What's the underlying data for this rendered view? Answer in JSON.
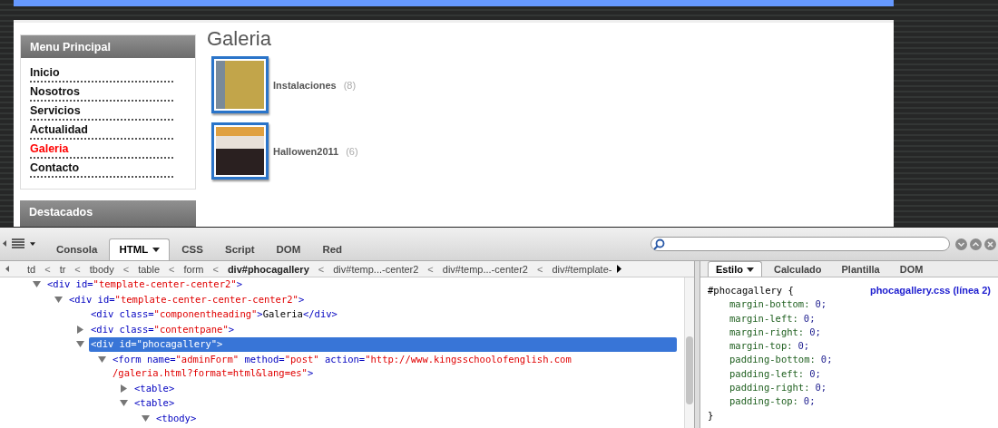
{
  "page": {
    "menu": {
      "title": "Menu Principal",
      "items": [
        {
          "label": "Inicio",
          "selected": false
        },
        {
          "label": "Nosotros",
          "selected": false
        },
        {
          "label": "Servicios",
          "selected": false
        },
        {
          "label": "Actualidad",
          "selected": false
        },
        {
          "label": "Galeria",
          "selected": true
        },
        {
          "label": "Contacto",
          "selected": false
        }
      ]
    },
    "featured": {
      "title": "Destacados"
    },
    "heading": "Galeria",
    "albums": [
      {
        "name": "Instalaciones",
        "count": "(8)"
      },
      {
        "name": "Hallowen2011",
        "count": "(6)"
      }
    ]
  },
  "devtools": {
    "tabs": [
      {
        "label": "Consola",
        "selected": false,
        "dropdown": false
      },
      {
        "label": "HTML",
        "selected": true,
        "dropdown": true
      },
      {
        "label": "CSS",
        "selected": false,
        "dropdown": false
      },
      {
        "label": "Script",
        "selected": false,
        "dropdown": false
      },
      {
        "label": "DOM",
        "selected": false,
        "dropdown": false
      },
      {
        "label": "Red",
        "selected": false,
        "dropdown": false
      }
    ],
    "breadcrumb": [
      {
        "label": "td",
        "selected": false,
        "separator": "<"
      },
      {
        "label": "tr",
        "selected": false,
        "separator": "<"
      },
      {
        "label": "tbody",
        "selected": false,
        "separator": "<"
      },
      {
        "label": "table",
        "selected": false,
        "separator": "<"
      },
      {
        "label": "form",
        "selected": false,
        "separator": "<"
      },
      {
        "label": "div#phocagallery",
        "selected": true,
        "separator": "<"
      },
      {
        "label": "div#temp...-center2",
        "selected": false,
        "separator": "<"
      },
      {
        "label": "div#temp...-center2",
        "selected": false,
        "separator": "<"
      },
      {
        "label": "div#template-",
        "selected": false
      }
    ],
    "tree": [
      {
        "expanded": true,
        "selected": false,
        "tokens": [
          {
            "kind": "tag",
            "text": "<div"
          },
          {
            "kind": "attr",
            "text": " id="
          },
          {
            "kind": "value",
            "text": "\"template-center-center2\""
          },
          {
            "kind": "tag",
            "text": ">"
          }
        ],
        "children": [
          {
            "expanded": true,
            "selected": false,
            "tokens": [
              {
                "kind": "tag",
                "text": "<div"
              },
              {
                "kind": "attr",
                "text": " id="
              },
              {
                "kind": "value",
                "text": "\"template-center-center-center2\""
              },
              {
                "kind": "tag",
                "text": ">"
              }
            ],
            "children": [
              {
                "selected": false,
                "tokens": [
                  {
                    "kind": "tag",
                    "text": "<div"
                  },
                  {
                    "kind": "attr",
                    "text": " class="
                  },
                  {
                    "kind": "value",
                    "text": "\"componentheading\""
                  },
                  {
                    "kind": "tag",
                    "text": ">"
                  },
                  {
                    "kind": "text",
                    "text": "Galeria"
                  },
                  {
                    "kind": "tag",
                    "text": "</div>"
                  }
                ]
              },
              {
                "expanded": false,
                "selected": false,
                "tokens": [
                  {
                    "kind": "tag",
                    "text": "<div"
                  },
                  {
                    "kind": "attr",
                    "text": " class="
                  },
                  {
                    "kind": "value",
                    "text": "\"contentpane\""
                  },
                  {
                    "kind": "tag",
                    "text": ">"
                  }
                ]
              },
              {
                "expanded": true,
                "selected": true,
                "tokens": [
                  {
                    "kind": "tag",
                    "text": "<div"
                  },
                  {
                    "kind": "attr",
                    "text": " id="
                  },
                  {
                    "kind": "value",
                    "text": "\"phocagallery\""
                  },
                  {
                    "kind": "tag",
                    "text": ">"
                  }
                ],
                "children": [
                  {
                    "expanded": true,
                    "selected": false,
                    "tokens": [
                      {
                        "kind": "tag",
                        "text": "<form"
                      },
                      {
                        "kind": "attr",
                        "text": " name="
                      },
                      {
                        "kind": "value",
                        "text": "\"adminForm\""
                      },
                      {
                        "kind": "attr",
                        "text": " method="
                      },
                      {
                        "kind": "value",
                        "text": "\"post\""
                      },
                      {
                        "kind": "attr",
                        "text": " action="
                      },
                      {
                        "kind": "value",
                        "text": "\"http://www.kingsschoolofenglish.com\n/galeria.html?format=html&lang=es\""
                      },
                      {
                        "kind": "tag",
                        "text": ">"
                      }
                    ],
                    "children": [
                      {
                        "expanded": false,
                        "selected": false,
                        "tokens": [
                          {
                            "kind": "tag",
                            "text": "<table>"
                          }
                        ]
                      },
                      {
                        "expanded": true,
                        "selected": false,
                        "tokens": [
                          {
                            "kind": "tag",
                            "text": "<table>"
                          }
                        ],
                        "children": [
                          {
                            "expanded": true,
                            "selected": false,
                            "tokens": [
                              {
                                "kind": "tag",
                                "text": "<tbody>"
                              }
                            ]
                          }
                        ]
                      }
                    ]
                  }
                ]
              }
            ]
          }
        ]
      }
    ],
    "side_tabs": [
      {
        "label": "Estilo",
        "selected": true,
        "dropdown": true
      },
      {
        "label": "Calculado",
        "selected": false,
        "dropdown": false
      },
      {
        "label": "Plantilla",
        "selected": false,
        "dropdown": false
      },
      {
        "label": "DOM",
        "selected": false,
        "dropdown": false
      }
    ],
    "rule": {
      "selector": "#phocagallery {",
      "source": "phocagallery.css (línea 2)",
      "close": "}",
      "declarations": [
        {
          "property": "margin-bottom:",
          "value": "0;"
        },
        {
          "property": "margin-left:",
          "value": "0;"
        },
        {
          "property": "margin-right:",
          "value": "0;"
        },
        {
          "property": "margin-top:",
          "value": "0;"
        },
        {
          "property": "padding-bottom:",
          "value": "0;"
        },
        {
          "property": "padding-left:",
          "value": "0;"
        },
        {
          "property": "padding-right:",
          "value": "0;"
        },
        {
          "property": "padding-top:",
          "value": "0;"
        }
      ]
    }
  }
}
